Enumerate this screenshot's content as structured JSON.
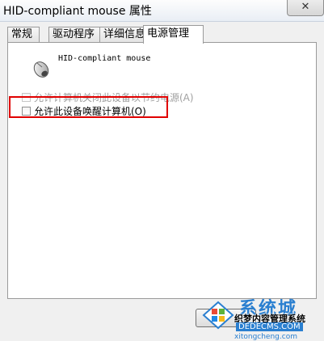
{
  "window": {
    "title": "HID-compliant mouse 属性",
    "close_glyph": "✕"
  },
  "tabs": [
    {
      "label": "常规"
    },
    {
      "label": "驱动程序"
    },
    {
      "label": "详细信息"
    },
    {
      "label": "电源管理",
      "active": true
    }
  ],
  "device": {
    "name": "HID-compliant mouse",
    "icon": "mouse-icon"
  },
  "options": {
    "allow_turn_off": {
      "label": "允许计算机关闭此设备以节约电源(A)",
      "checked": false,
      "enabled": false
    },
    "allow_wake": {
      "label": "允许此设备唤醒计算机(O)",
      "checked": false,
      "enabled": true
    }
  },
  "watermark": {
    "big_text": "系统城",
    "sub_text": "织梦内容管理系统",
    "site_text": "DEDECMS.COM",
    "url_text": "xitongcheng.com"
  },
  "colors": {
    "highlight": "#e00000",
    "accent": "#2a7fd0"
  }
}
